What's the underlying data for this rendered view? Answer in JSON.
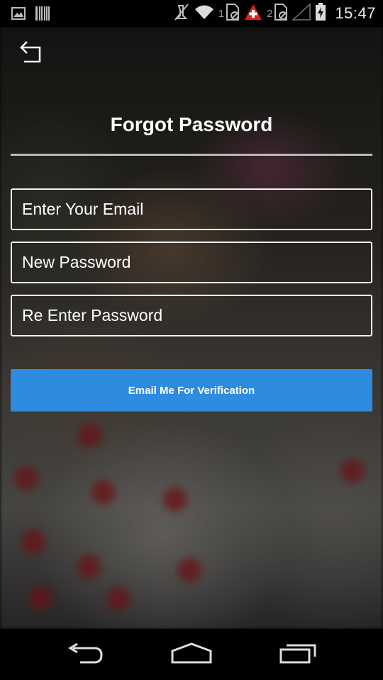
{
  "status_bar": {
    "time": "15:47",
    "sim1_label": "1",
    "sim2_label": "2",
    "icons": [
      "image-icon",
      "barcode-icon",
      "mute-icon",
      "wifi-icon",
      "sim-icon",
      "alert-icon",
      "sim-icon",
      "signal-icon",
      "battery-icon"
    ]
  },
  "header": {
    "back_icon": "back-arrow-icon",
    "title": "Forgot Password"
  },
  "form": {
    "email_placeholder": "Enter Your Email",
    "new_password_placeholder": "New Password",
    "reenter_password_placeholder": "Re Enter Password",
    "submit_label": "Email Me For Verification"
  },
  "nav_bar": {
    "icons": [
      "back-icon",
      "home-icon",
      "recents-icon"
    ]
  },
  "colors": {
    "accent": "#2d8be0",
    "alert_red": "#e0201e",
    "divider": "#b9b9b9"
  }
}
